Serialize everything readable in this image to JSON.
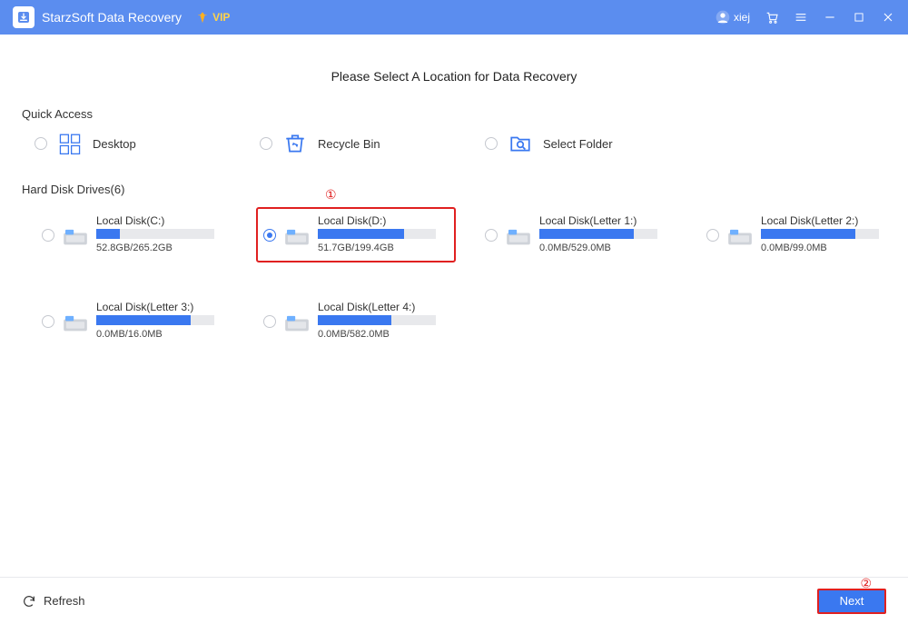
{
  "titlebar": {
    "app_name": "StarzSoft Data Recovery",
    "vip_label": "VIP",
    "user_name": "xiej"
  },
  "heading": "Please Select A Location for Data Recovery",
  "quick_access": {
    "label": "Quick Access",
    "items": [
      {
        "label": "Desktop",
        "icon": "desktop"
      },
      {
        "label": "Recycle Bin",
        "icon": "bin"
      },
      {
        "label": "Select Folder",
        "icon": "folder"
      }
    ]
  },
  "drives": {
    "label": "Hard Disk Drives(6)",
    "selected_index": 1,
    "items": [
      {
        "name": "Local Disk(C:)",
        "usage": "52.8GB/265.2GB",
        "fill_pct": 20
      },
      {
        "name": "Local Disk(D:)",
        "usage": "51.7GB/199.4GB",
        "fill_pct": 73
      },
      {
        "name": "Local Disk(Letter 1:)",
        "usage": "0.0MB/529.0MB",
        "fill_pct": 80
      },
      {
        "name": "Local Disk(Letter 2:)",
        "usage": "0.0MB/99.0MB",
        "fill_pct": 80
      },
      {
        "name": "Local Disk(Letter 3:)",
        "usage": "0.0MB/16.0MB",
        "fill_pct": 80
      },
      {
        "name": "Local Disk(Letter 4:)",
        "usage": "0.0MB/582.0MB",
        "fill_pct": 62
      }
    ]
  },
  "footer": {
    "refresh_label": "Refresh",
    "next_label": "Next"
  },
  "annotations": {
    "step1": "①",
    "step2": "②"
  }
}
